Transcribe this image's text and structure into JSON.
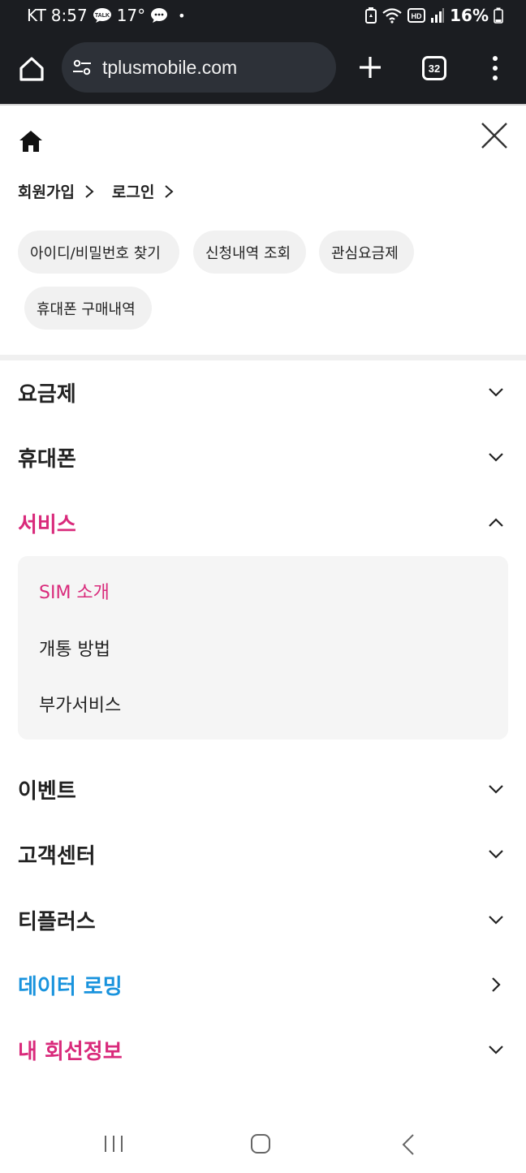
{
  "status_bar": {
    "carrier": "KT",
    "time": "8:57",
    "talk_badge": "TALK",
    "temperature": "17°",
    "dot": "•",
    "hd_badge": "HD",
    "battery": "16%"
  },
  "browser": {
    "url": "tplusmobile.com",
    "tab_count": "32"
  },
  "menu": {
    "auth_links": [
      {
        "label": "회원가입"
      },
      {
        "label": "로그인"
      }
    ],
    "chips": [
      {
        "label": "아이디/비밀번호 찾기"
      },
      {
        "label": "신청내역 조회"
      },
      {
        "label": "관심요금제"
      },
      {
        "label": "휴대폰 구매내역"
      }
    ],
    "nav": [
      {
        "label": "요금제",
        "state": "collapsed"
      },
      {
        "label": "휴대폰",
        "state": "collapsed"
      },
      {
        "label": "서비스",
        "state": "expanded"
      },
      {
        "label": "이벤트",
        "state": "collapsed"
      },
      {
        "label": "고객센터",
        "state": "collapsed"
      },
      {
        "label": "티플러스",
        "state": "collapsed"
      },
      {
        "label": "데이터 로밍",
        "state": "link"
      },
      {
        "label": "내 회선정보",
        "state": "collapsed"
      }
    ],
    "service_submenu": [
      {
        "label": "SIM 소개",
        "active": true
      },
      {
        "label": "개통 방법",
        "active": false
      },
      {
        "label": "부가서비스",
        "active": false
      }
    ]
  },
  "colors": {
    "accent_pink": "#d92a7b",
    "accent_blue": "#1993dd",
    "browser_dark": "#1b1d21"
  }
}
